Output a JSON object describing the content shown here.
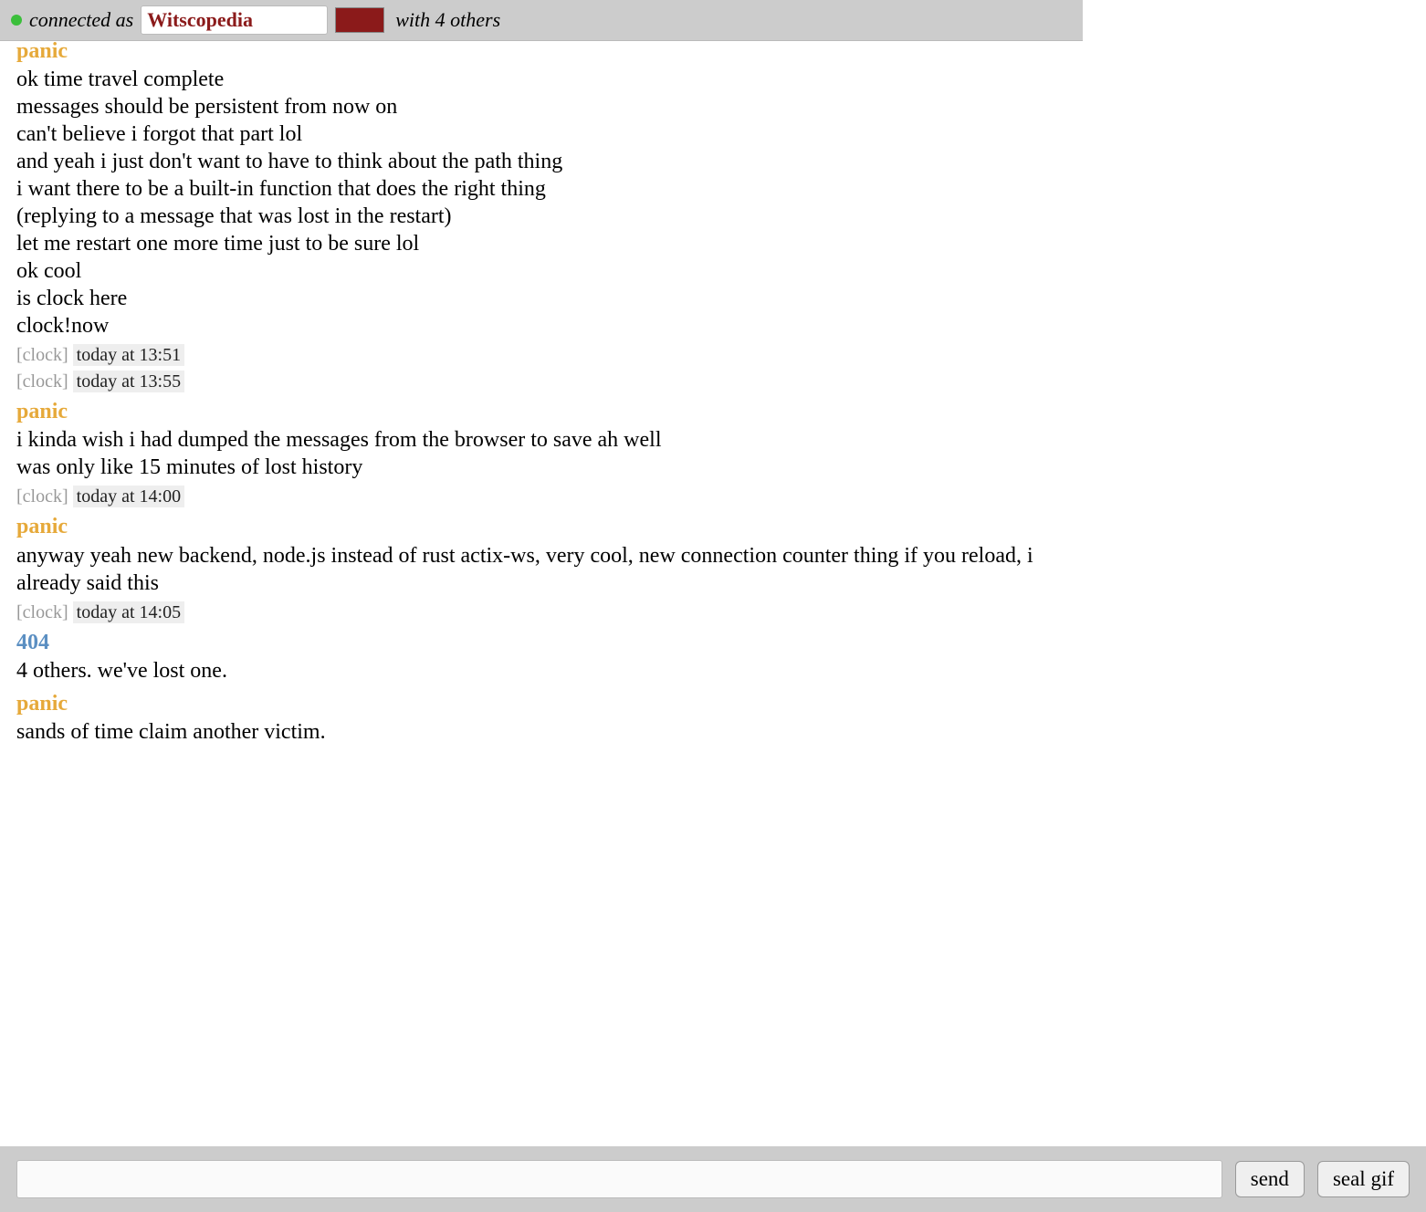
{
  "header": {
    "connected_label": "connected as",
    "username": "Witscopedia",
    "color": "#8b1a1a",
    "with_label": "with 4 others"
  },
  "messages": [
    {
      "type": "user",
      "name": "panic",
      "class": "panic",
      "lines": [
        "ok time travel complete",
        "messages should be persistent from now on",
        "can't believe i forgot that part lol",
        "and yeah i just don't want to have to think about the path thing",
        "i want there to be a built-in function that does the right thing",
        "(replying to a message that was lost in the restart)",
        "let me restart one more time just to be sure lol",
        "ok cool",
        "is clock here",
        "clock!now"
      ]
    },
    {
      "type": "system",
      "label": "[clock]",
      "time": "today at 13:51"
    },
    {
      "type": "system",
      "label": "[clock]",
      "time": "today at 13:55"
    },
    {
      "type": "user",
      "name": "panic",
      "class": "panic",
      "lines": [
        "i kinda wish i had dumped the messages from the browser to save ah well",
        "was only like 15 minutes of lost history"
      ]
    },
    {
      "type": "system",
      "label": "[clock]",
      "time": "today at 14:00"
    },
    {
      "type": "user",
      "name": "panic",
      "class": "panic",
      "lines": [
        "anyway yeah new backend, node.js instead of rust actix-ws, very cool, new connection counter thing if you reload, i already said this"
      ]
    },
    {
      "type": "system",
      "label": "[clock]",
      "time": "today at 14:05"
    },
    {
      "type": "user",
      "name": "404",
      "class": "u404",
      "lines": [
        "4 others. we've lost one."
      ]
    },
    {
      "type": "user",
      "name": "panic",
      "class": "panic",
      "lines": [
        "sands of time claim another victim."
      ]
    }
  ],
  "footer": {
    "compose_value": "",
    "send_label": "send",
    "seal_label": "seal gif"
  }
}
